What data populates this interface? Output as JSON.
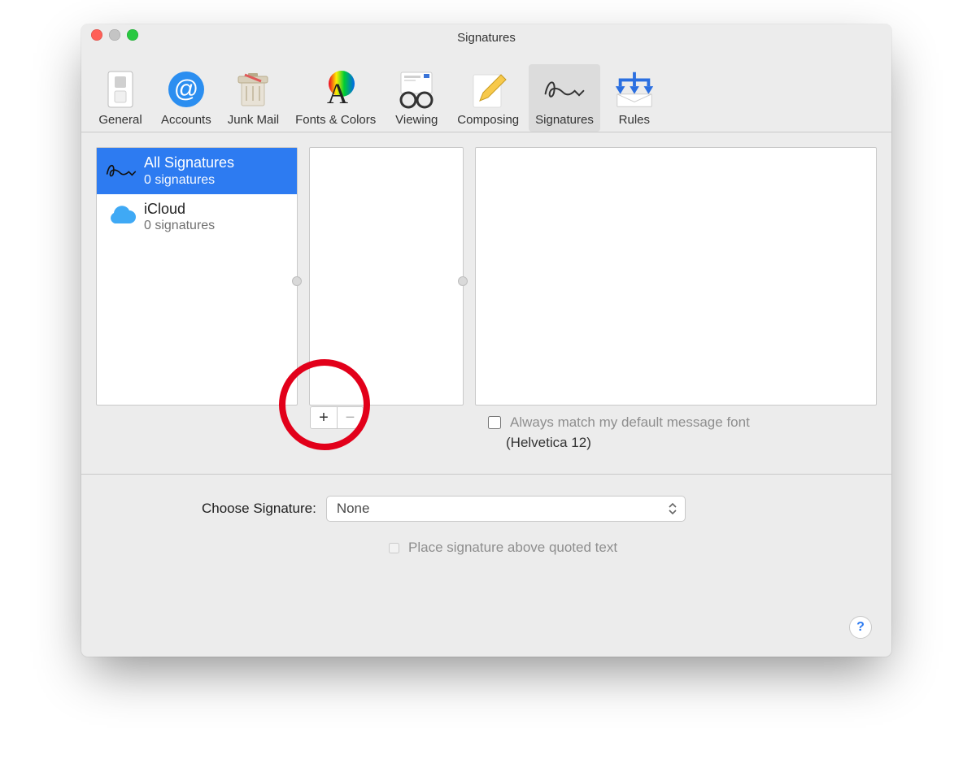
{
  "window": {
    "title": "Signatures"
  },
  "toolbar": {
    "tabs": [
      {
        "label": "General"
      },
      {
        "label": "Accounts"
      },
      {
        "label": "Junk Mail"
      },
      {
        "label": "Fonts & Colors"
      },
      {
        "label": "Viewing"
      },
      {
        "label": "Composing"
      },
      {
        "label": "Signatures"
      },
      {
        "label": "Rules"
      }
    ],
    "active_index": 6
  },
  "accounts": [
    {
      "name": "All Signatures",
      "sub": "0 signatures",
      "selected": true
    },
    {
      "name": "iCloud",
      "sub": "0 signatures",
      "selected": false
    }
  ],
  "signature_list": {
    "items": [],
    "add_label": "+",
    "remove_label": "−"
  },
  "match_font": {
    "checkbox_label": "Always match my default message font",
    "checked": false,
    "font": "(Helvetica 12)"
  },
  "choose": {
    "label": "Choose Signature:",
    "value": "None"
  },
  "place_above": {
    "label": "Place signature above quoted text",
    "checked": false
  },
  "help": {
    "label": "?"
  }
}
